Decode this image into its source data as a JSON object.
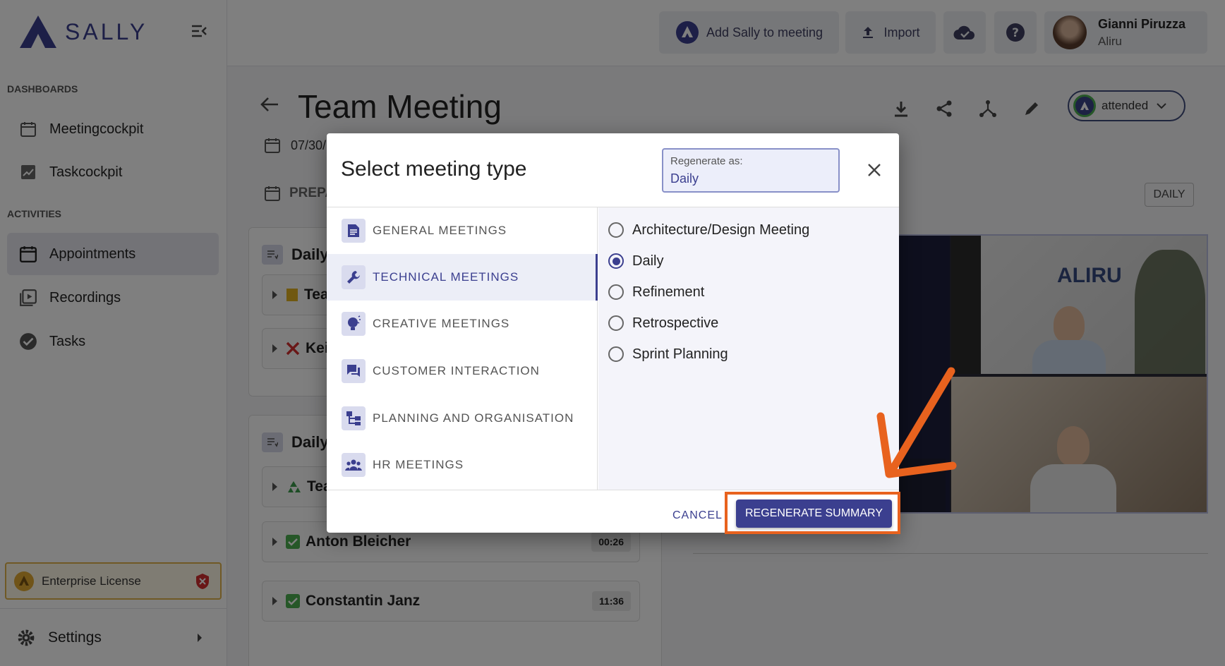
{
  "app": {
    "logo_text": "SALLY"
  },
  "sidebar": {
    "sections": [
      {
        "label": "DASHBOARDS"
      },
      {
        "label": "ACTIVITIES"
      }
    ],
    "items": [
      {
        "label": "Meetingcockpit",
        "icon": "calendar-icon"
      },
      {
        "label": "Taskcockpit",
        "icon": "chart-icon"
      },
      {
        "label": "Appointments",
        "icon": "calendar-icon",
        "active": true
      },
      {
        "label": "Recordings",
        "icon": "play-library-icon"
      },
      {
        "label": "Tasks",
        "icon": "check-circle-icon"
      }
    ],
    "license": "Enterprise License",
    "settings": "Settings"
  },
  "header": {
    "add_sally": "Add Sally to meeting",
    "import": "Import",
    "user": {
      "name": "Gianni Piruzza",
      "org": "Aliru"
    }
  },
  "meeting": {
    "title": "Team Meeting",
    "date": "07/30/",
    "prep": "PREPA",
    "status": "attended",
    "tag": "DAILY",
    "panels": [
      {
        "header": "Daily :",
        "rows": [
          {
            "label": "Tea",
            "marker": "note"
          },
          {
            "label": "Kei",
            "marker": "cross"
          }
        ]
      },
      {
        "header": "Daily :",
        "rows": [
          {
            "label": "Tea",
            "marker": "recycle"
          },
          {
            "label": "Anton Bleicher",
            "marker": "check",
            "time": "00:26"
          },
          {
            "label": "Constantin Janz",
            "marker": "check",
            "time": "11:36"
          }
        ]
      }
    ],
    "video_brand": "ALIRU"
  },
  "dialog": {
    "title": "Select meeting type",
    "regen_label": "Regenerate as:",
    "regen_value": "Daily",
    "categories": [
      {
        "label": "GENERAL MEETINGS",
        "icon": "document-icon"
      },
      {
        "label": "TECHNICAL MEETINGS",
        "icon": "wrench-icon",
        "active": true
      },
      {
        "label": "CREATIVE MEETINGS",
        "icon": "lightbulb-icon"
      },
      {
        "label": "CUSTOMER INTERACTION",
        "icon": "chat-icon"
      },
      {
        "label": "PLANNING AND ORGANISATION",
        "icon": "org-chart-icon"
      },
      {
        "label": "HR MEETINGS",
        "icon": "people-icon"
      }
    ],
    "options": [
      {
        "label": "Architecture/Design Meeting",
        "selected": false
      },
      {
        "label": "Daily",
        "selected": true
      },
      {
        "label": "Refinement",
        "selected": false
      },
      {
        "label": "Retrospective",
        "selected": false
      },
      {
        "label": "Sprint Planning",
        "selected": false
      }
    ],
    "cancel": "CANCEL",
    "regenerate": "REGENERATE SUMMARY"
  },
  "colors": {
    "accent": "#3b3f8f",
    "highlight": "#e8621e"
  }
}
